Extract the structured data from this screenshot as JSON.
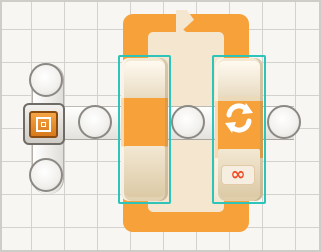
{
  "program": {
    "start": {
      "icon": "start-icon"
    },
    "action_slot": {
      "state": "empty"
    },
    "loop": {
      "icon": "loop-cycle-icon",
      "control": "∞",
      "color": "#f6a13a"
    },
    "selection_color": "#2ec4b9"
  }
}
